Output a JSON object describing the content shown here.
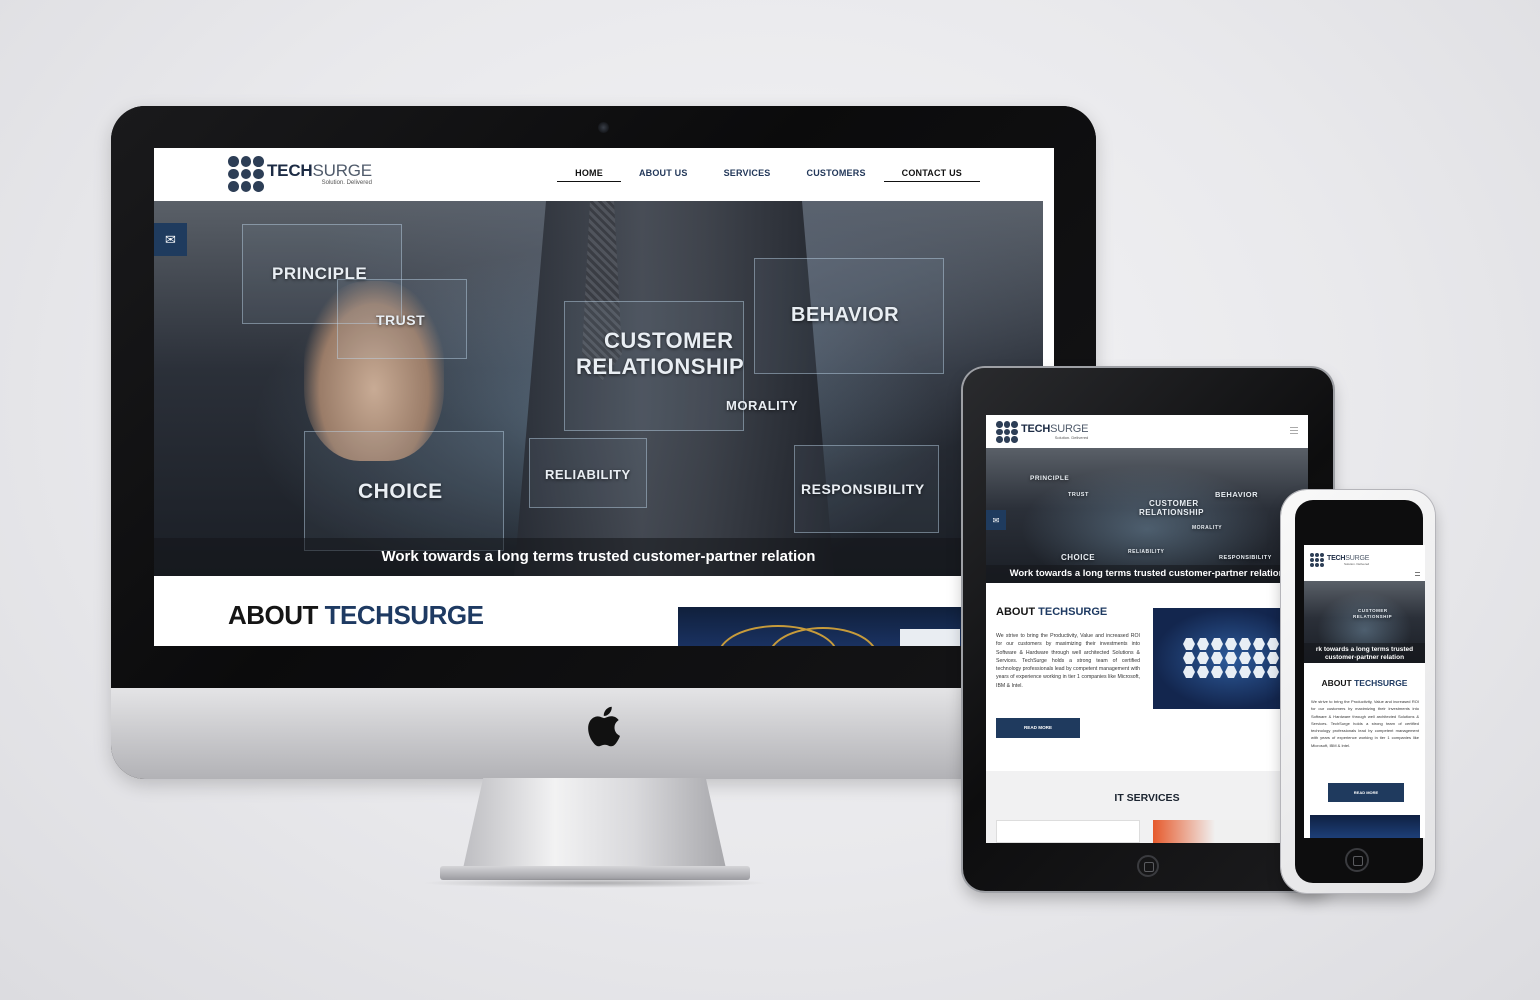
{
  "brand": {
    "name_bold": "TECH",
    "name_light": "SURGE",
    "tagline": "Solution. Delivered"
  },
  "nav": {
    "items": [
      {
        "label": "HOME",
        "active": true
      },
      {
        "label": "ABOUT US",
        "active": false
      },
      {
        "label": "SERVICES",
        "active": false
      },
      {
        "label": "CUSTOMERS",
        "active": false
      },
      {
        "label": "CONTACT US",
        "active": false
      }
    ]
  },
  "hero": {
    "words": {
      "principle": "PRINCIPLE",
      "trust": "TRUST",
      "customer": "CUSTOMER",
      "relationship": "RELATIONSHIP",
      "behavior": "BEHAVIOR",
      "morality": "MORALITY",
      "choice": "CHOICE",
      "reliability": "RELIABILITY",
      "responsibility": "RESPONSIBILITY"
    },
    "caption": "Work towards a long terms trusted customer-partner relation",
    "caption_tablet": "Work towards a long terms trusted customer-partner relation",
    "caption_phone": "rk towards a long terms trusted customer-partner relation"
  },
  "about": {
    "title_main": "ABOUT ",
    "title_accent": "TECHSURGE",
    "body": "We strive to bring the Productivity, Value and increased ROI for our customers by maximizing their investments into Software & Hardware through well architected Solutions & Services. TechSurge holds a strong team of certified technology professionals lead by competent management with years of experience working in tier 1 companies like Microsoft, IBM & Intel.",
    "read_more": "READ MORE"
  },
  "services": {
    "title_main": "IT ",
    "title_accent": "SERVICES"
  },
  "icons": {
    "mail": "mail-icon",
    "menu": "hamburger-menu-icon",
    "apple": "apple-logo-icon"
  },
  "colors": {
    "brand_navy": "#1f3a5e",
    "heading_accent": "#1e3a62",
    "text_dark": "#151515"
  }
}
